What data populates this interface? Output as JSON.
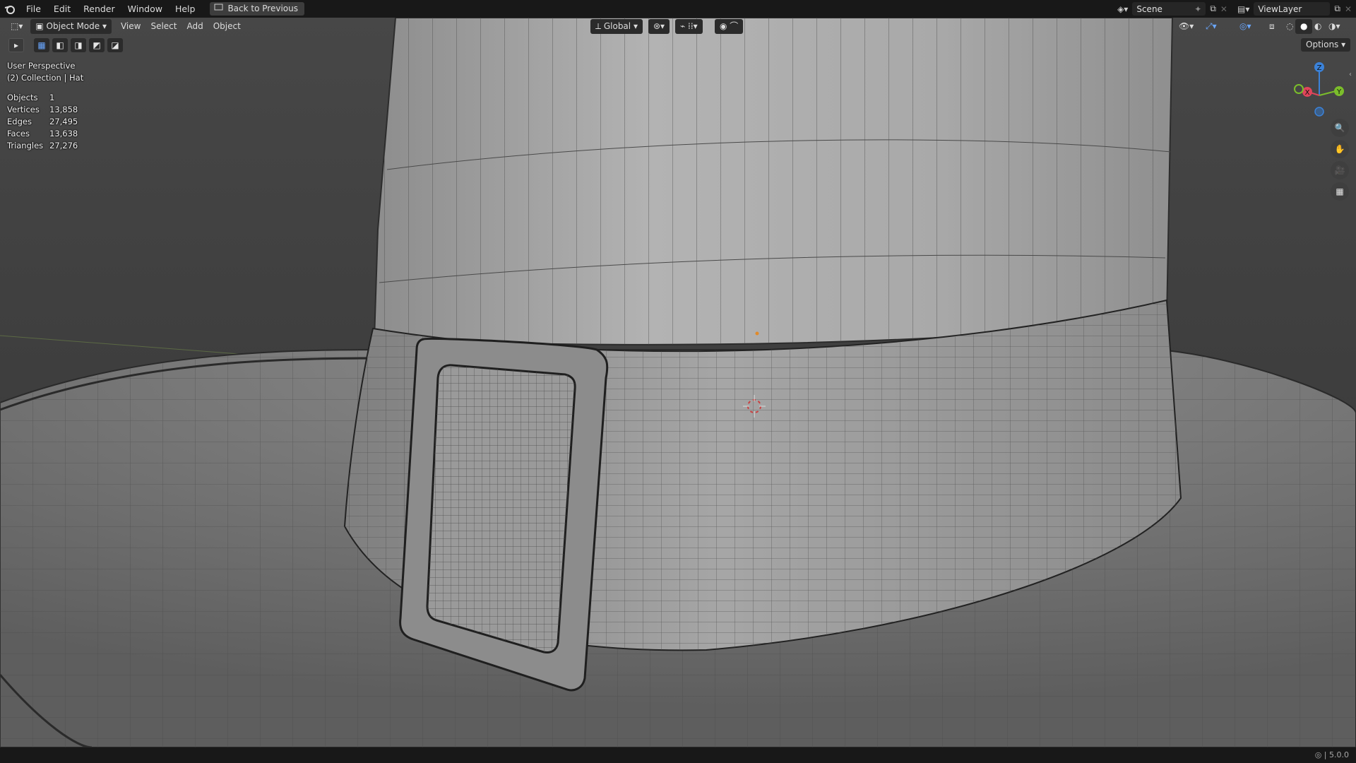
{
  "menus": [
    "File",
    "Edit",
    "Render",
    "Window",
    "Help"
  ],
  "back_button": "Back to Previous",
  "scene_field": "Scene",
  "viewlayer_field": "ViewLayer",
  "header": {
    "mode": "Object Mode",
    "menus": [
      "View",
      "Select",
      "Add",
      "Object"
    ],
    "transform_orientation": "Global",
    "options": "Options"
  },
  "overlay": {
    "view_name": "User Perspective",
    "collection": "(2) Collection | Hat",
    "stats": [
      {
        "label": "Objects",
        "value": "1"
      },
      {
        "label": "Vertices",
        "value": "13,858"
      },
      {
        "label": "Edges",
        "value": "27,495"
      },
      {
        "label": "Faces",
        "value": "13,638"
      },
      {
        "label": "Triangles",
        "value": "27,276"
      }
    ]
  },
  "gizmo": {
    "x": "X",
    "y": "Y",
    "z": "Z"
  },
  "version": "5.0.0",
  "colors": {
    "topbar": "#181818",
    "viewport": "#3c3c3c",
    "axis_x": "#e0455a",
    "axis_y": "#7bbd2b",
    "axis_z": "#3b82d9"
  }
}
